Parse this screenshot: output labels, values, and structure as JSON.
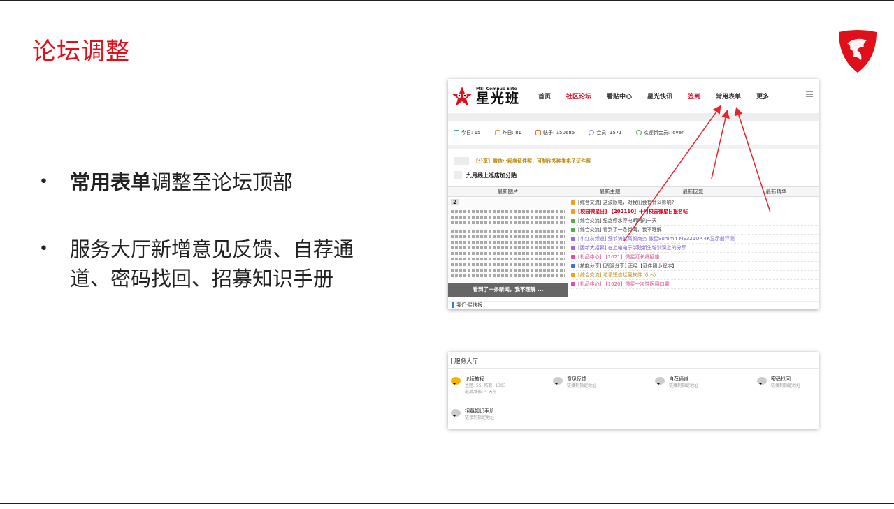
{
  "slide": {
    "title": "论坛调整",
    "bullets": [
      {
        "bold": "常用表单",
        "rest": "调整至论坛顶部"
      },
      {
        "bold": "",
        "rest": "服务大厅新增意见反馈、自荐通道、密码找回、招募知识手册"
      }
    ]
  },
  "forum": {
    "brand_small": "MSI Compus Elite",
    "brand_big": "星光班",
    "nav": [
      "首页",
      "社区论坛",
      "看贴中心",
      "星光快讯",
      "签到",
      "常用表单",
      "更多"
    ],
    "stats": [
      "今日: 15",
      "昨日: 81",
      "帖子: 150685",
      "会员: 1571",
      "欢迎新会员: lover"
    ],
    "notices": [
      "【分享】微信小程序证件照，可制作多种类电子证件照",
      "九月线上巡店加分贴"
    ],
    "tabs": [
      "最新图片",
      "最新主题",
      "最新回复",
      "最新精华"
    ],
    "image_number": "2",
    "image_caption": "看到了一条新闻，我不理解 ...",
    "topics": [
      {
        "text": "[综合交流] 这波限电，对我们会有什么影响?",
        "color": "#f0a020"
      },
      {
        "text": "[校园微星日] 【202110】十月校园微星日报名帖",
        "color": "#f0a020"
      },
      {
        "text": "[综合交流] 纪念停水停电断网的一天",
        "color": "#4caf50"
      },
      {
        "text": "[综合交流] 看到了一条新闻，我不理解",
        "color": "#4caf50"
      },
      {
        "text": "[小红灰频道] 细节铸就高颜商务 微星Summit MS321UP 4K显示器评测",
        "color": "#9c6ad6"
      },
      {
        "text": "[困新大招募] 在上电电子学院新生培训课上的分享",
        "color": "#9c6ad6"
      },
      {
        "text": "[礼品中心] 【1021】微星延长线插座",
        "color": "#e94e9c"
      },
      {
        "text": "[技能分享] [资源分享] 正经【证件照小程序】",
        "color": "#2e7bd6"
      },
      {
        "text": "[综合交流] 垃圾短信拦截软件（ios）",
        "color": "#f0a020"
      },
      {
        "text": "[礼品中心] 【1020】微星一次性医用口罩",
        "color": "#e94e9c"
      }
    ],
    "bottom_label": "我们·星快报"
  },
  "service": {
    "title": "服务大厅",
    "items": [
      {
        "name": "论坛教程",
        "sub1": "主题: 55, 帖数: 1303",
        "sub2": "最后发表: 4 天前"
      },
      {
        "name": "意见反馈",
        "sub1": "链接到指定地址",
        "sub2": ""
      },
      {
        "name": "自荐通道",
        "sub1": "链接到指定地址",
        "sub2": ""
      },
      {
        "name": "密码找回",
        "sub1": "链接到指定地址",
        "sub2": ""
      },
      {
        "name": "招募知识手册",
        "sub1": "链接到指定地址",
        "sub2": ""
      }
    ]
  },
  "colors": {
    "accent": "#e0101a",
    "arrow": "#e8232c"
  }
}
